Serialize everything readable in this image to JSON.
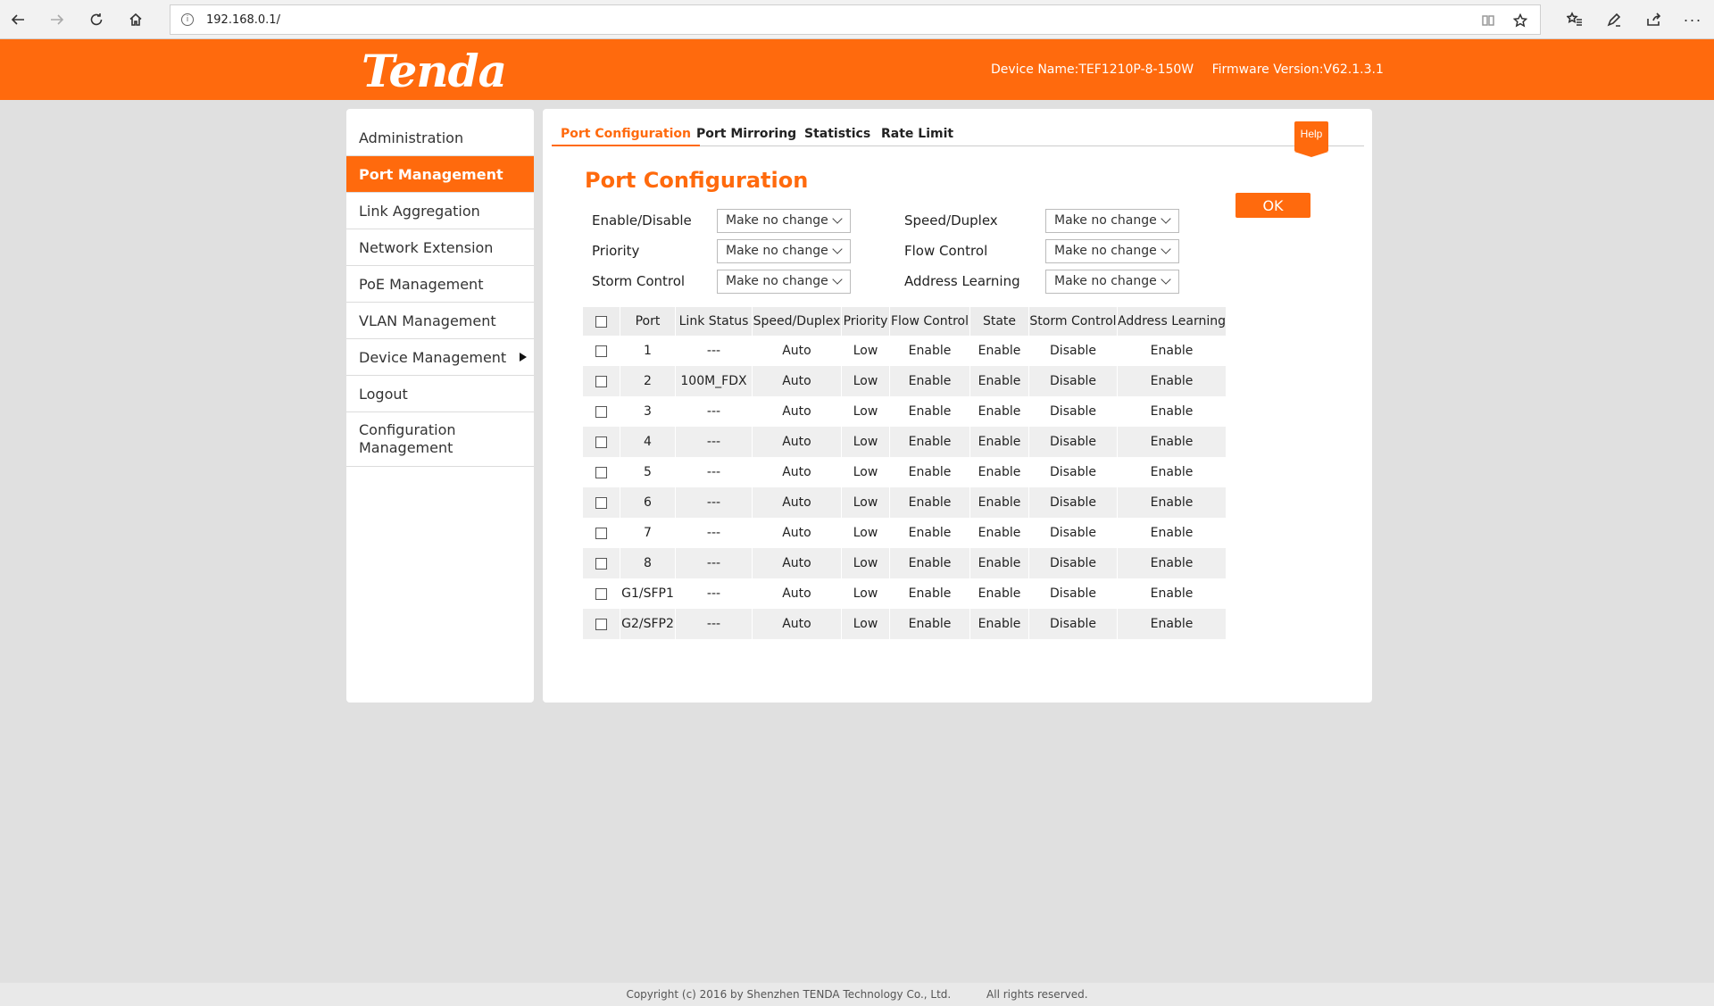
{
  "browser": {
    "url": "192.168.0.1/"
  },
  "header": {
    "logo_text": "Tenda",
    "device_name": "Device Name:TEF1210P-8-150W",
    "firmware": "Firmware Version:V62.1.3.1"
  },
  "sidebar": {
    "items": [
      {
        "label": "Administration"
      },
      {
        "label": "Port Management"
      },
      {
        "label": "Link Aggregation"
      },
      {
        "label": "Network Extension"
      },
      {
        "label": "PoE Management"
      },
      {
        "label": "VLAN Management"
      },
      {
        "label": "Device Management"
      },
      {
        "label": "Logout"
      },
      {
        "label": "Configuration Management"
      }
    ],
    "active": "Port Management"
  },
  "tabs": [
    {
      "label": "Port Configuration"
    },
    {
      "label": "Port Mirroring"
    },
    {
      "label": "Statistics"
    },
    {
      "label": "Rate Limit"
    }
  ],
  "help_label": "Help",
  "page_title": "Port Configuration",
  "ok_label": "OK",
  "form": {
    "enable_disable": {
      "label": "Enable/Disable",
      "value": "Make no change"
    },
    "speed_duplex": {
      "label": "Speed/Duplex",
      "value": "Make no change"
    },
    "priority": {
      "label": "Priority",
      "value": "Make no change"
    },
    "flow_control": {
      "label": "Flow Control",
      "value": "Make no change"
    },
    "storm_control": {
      "label": "Storm Control",
      "value": "Make no change"
    },
    "address_learning": {
      "label": "Address Learning",
      "value": "Make no change"
    }
  },
  "table": {
    "headers": [
      "Port",
      "Link Status",
      "Speed/Duplex",
      "Priority",
      "Flow Control",
      "State",
      "Storm Control",
      "Address Learning"
    ],
    "rows": [
      [
        "1",
        "---",
        "Auto",
        "Low",
        "Enable",
        "Enable",
        "Disable",
        "Enable"
      ],
      [
        "2",
        "100M_FDX",
        "Auto",
        "Low",
        "Enable",
        "Enable",
        "Disable",
        "Enable"
      ],
      [
        "3",
        "---",
        "Auto",
        "Low",
        "Enable",
        "Enable",
        "Disable",
        "Enable"
      ],
      [
        "4",
        "---",
        "Auto",
        "Low",
        "Enable",
        "Enable",
        "Disable",
        "Enable"
      ],
      [
        "5",
        "---",
        "Auto",
        "Low",
        "Enable",
        "Enable",
        "Disable",
        "Enable"
      ],
      [
        "6",
        "---",
        "Auto",
        "Low",
        "Enable",
        "Enable",
        "Disable",
        "Enable"
      ],
      [
        "7",
        "---",
        "Auto",
        "Low",
        "Enable",
        "Enable",
        "Disable",
        "Enable"
      ],
      [
        "8",
        "---",
        "Auto",
        "Low",
        "Enable",
        "Enable",
        "Disable",
        "Enable"
      ],
      [
        "G1/SFP1",
        "---",
        "Auto",
        "Low",
        "Enable",
        "Enable",
        "Disable",
        "Enable"
      ],
      [
        "G2/SFP2",
        "---",
        "Auto",
        "Low",
        "Enable",
        "Enable",
        "Disable",
        "Enable"
      ]
    ]
  },
  "footer": {
    "copyright": "Copyright (c) 2016 by Shenzhen TENDA Technology Co., Ltd.",
    "rights": "All rights reserved."
  },
  "colors": {
    "accent": "#ff6a0d",
    "background": "#e0e0e0"
  }
}
